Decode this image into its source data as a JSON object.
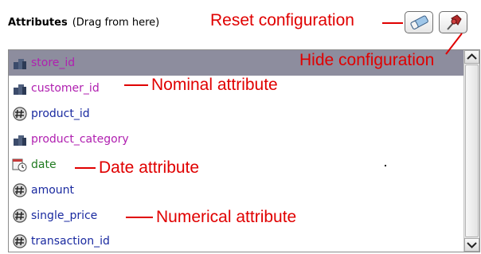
{
  "header": {
    "title": "Attributes",
    "hint": "(Drag from here)"
  },
  "toolbar": {
    "reset_icon": "eraser-icon",
    "hide_icon": "pin-icon"
  },
  "attributes": [
    {
      "name": "store_id",
      "kind": "nominal",
      "selected": true
    },
    {
      "name": "customer_id",
      "kind": "nominal",
      "selected": false
    },
    {
      "name": "product_id",
      "kind": "numerical",
      "selected": false
    },
    {
      "name": "product_category",
      "kind": "nominal",
      "selected": false
    },
    {
      "name": "date",
      "kind": "date",
      "selected": false
    },
    {
      "name": "amount",
      "kind": "numerical",
      "selected": false
    },
    {
      "name": "single_price",
      "kind": "numerical",
      "selected": false
    },
    {
      "name": "transaction_id",
      "kind": "numerical",
      "selected": false
    }
  ],
  "annotations": {
    "reset": "Reset configuration",
    "hide": "Hide configuration",
    "nominal": "Nominal attribute",
    "date": "Date attribute",
    "numerical": "Numerical attribute"
  },
  "colors": {
    "nominal": "#b020b0",
    "numerical": "#1a2aa0",
    "date": "#1f7a1f",
    "annotation": "#e00000",
    "selection": "#8d8d9e"
  }
}
